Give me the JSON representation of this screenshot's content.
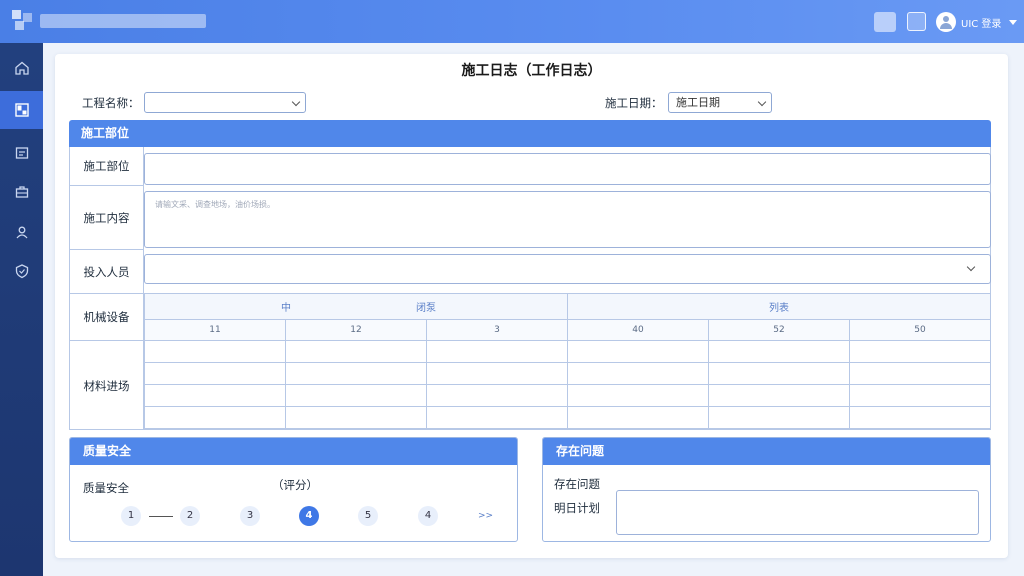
{
  "header": {
    "user_label": "UIC 登录"
  },
  "sidebar": {
    "items": [
      {
        "icon": "home-icon"
      },
      {
        "icon": "dashboard-icon",
        "active": true
      },
      {
        "icon": "document-icon"
      },
      {
        "icon": "briefcase-icon"
      },
      {
        "icon": "users-icon"
      },
      {
        "icon": "shield-icon"
      }
    ]
  },
  "page": {
    "title": "施工日志（工作日志）"
  },
  "filters": {
    "project_label": "工程名称：",
    "project_value": "",
    "date_label": "施工日期：",
    "date_value": "施工日期"
  },
  "section": {
    "title": "施工部位"
  },
  "form": {
    "location_label": "施工部位",
    "content_label": "施工内容",
    "content_placeholder": "请输文采、调查地场，油价场损。",
    "staff_label": "投入人员",
    "equipment_label": "机械设备",
    "materials_label": "材料进场"
  },
  "equipment_table": {
    "group_headers": [
      "中",
      "闭泵",
      "列表"
    ],
    "column_headers": [
      "11",
      "12",
      "3",
      "40",
      "52",
      "50"
    ],
    "data_rows": 4
  },
  "quality": {
    "title": "质量安全",
    "label": "质量安全",
    "score_label": "（评分）",
    "scores": [
      "1",
      "2",
      "3",
      "4",
      "5",
      "4"
    ],
    "active_index": 3,
    "more": ">>"
  },
  "issues": {
    "title": "存在问题",
    "issues_label": "存在问题",
    "plan_label": "明日计划"
  }
}
